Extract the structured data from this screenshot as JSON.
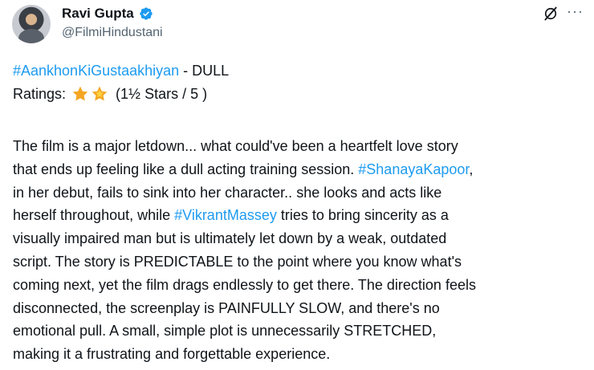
{
  "author": {
    "name": "Ravi Gupta",
    "handle": "@FilmiHindustani"
  },
  "icons": {
    "verified": "verified-badge-icon",
    "grok": "grok-icon",
    "more": "more-options-icon",
    "star": "star-icon"
  },
  "colors": {
    "link": "#1d9bf0",
    "verified": "#1d9bf0",
    "star": "#f5a623"
  },
  "tweet": {
    "headline_tag": "#AankhonKiGustaakhiyan",
    "headline_rest": " - DULL",
    "ratings_label": "Ratings:",
    "ratings_text": "(1½ Stars / 5 )",
    "rating_value": 1.5,
    "rating_max": 5,
    "body_lines": [
      [
        {
          "t": "The film is a major letdown... what could've been a heartfelt love story"
        }
      ],
      [
        {
          "t": "that ends up feeling like a dull acting training session. "
        },
        {
          "t": "#ShanayaKapoor",
          "link": true
        },
        {
          "t": ","
        }
      ],
      [
        {
          "t": "in her debut, fails to sink into her character.. she looks and acts like"
        }
      ],
      [
        {
          "t": "herself throughout, while "
        },
        {
          "t": "#VikrantMassey",
          "link": true
        },
        {
          "t": " tries to bring sincerity as a"
        }
      ],
      [
        {
          "t": "visually impaired man but is ultimately let down by a weak, outdated"
        }
      ],
      [
        {
          "t": "script. The story is PREDICTABLE to the point where you know what's"
        }
      ],
      [
        {
          "t": "coming next, yet the film drags endlessly to get there. The direction feels"
        }
      ],
      [
        {
          "t": "disconnected, the screenplay is PAINFULLY SLOW, and there's no"
        }
      ],
      [
        {
          "t": "emotional pull. A small, simple plot is unnecessarily STRETCHED,"
        }
      ],
      [
        {
          "t": "making it a frustrating and forgettable experience."
        }
      ]
    ]
  }
}
